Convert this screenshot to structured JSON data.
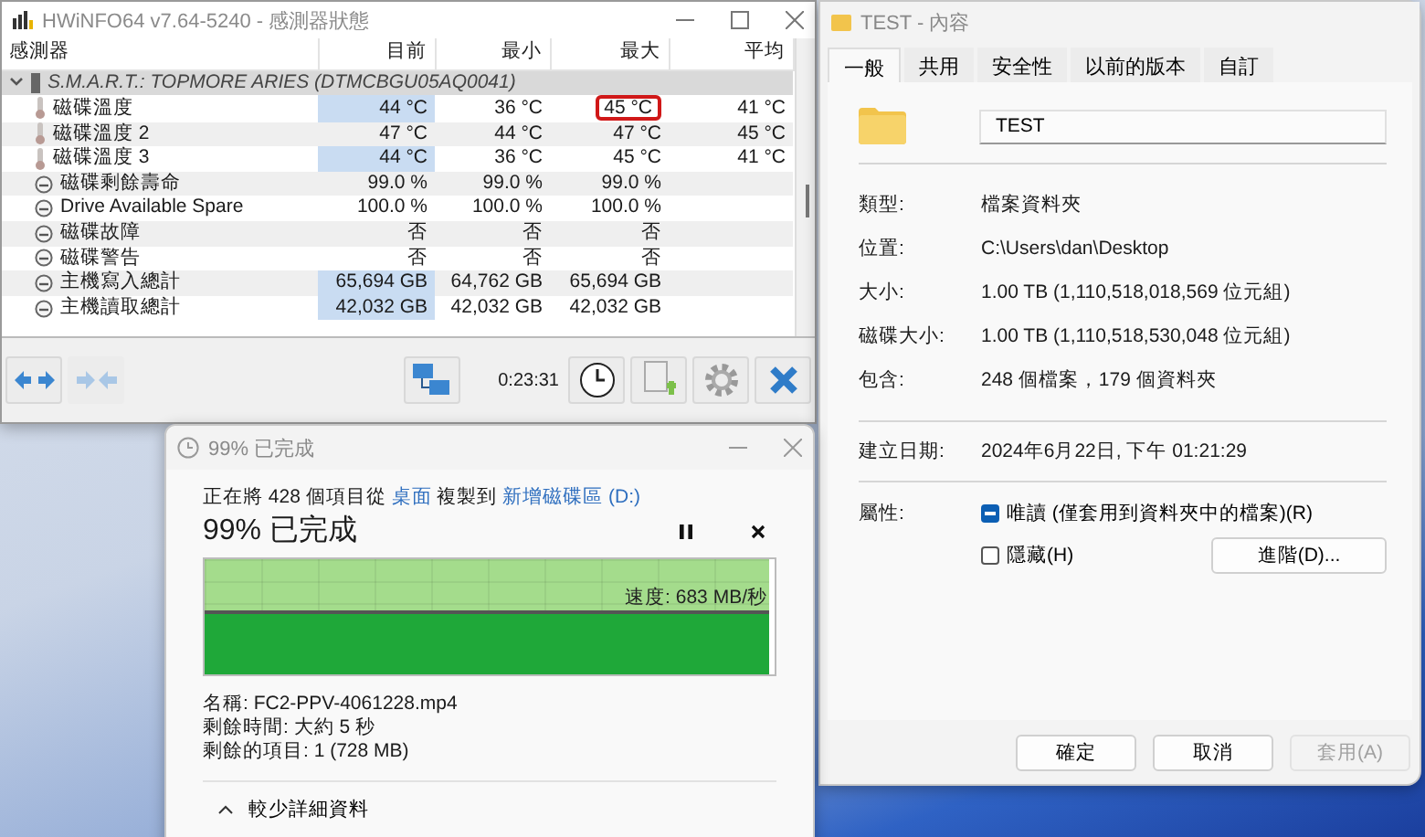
{
  "hwinfo": {
    "title": "HWiNFO64 v7.64-5240 - 感測器狀態",
    "columns": [
      "感測器",
      "目前",
      "最小",
      "最大",
      "平均"
    ],
    "group": {
      "label": "S.M.A.R.T.: TOPMORE ARIES (DTMCBGU05AQ0041)",
      "expanded": true
    },
    "rows": [
      {
        "kind": "temperature",
        "name": "磁碟溫度",
        "current": "44 °C",
        "min": "36 °C",
        "max": "45 °C",
        "avg": "41 °C",
        "highlighted": true,
        "max_marked": true
      },
      {
        "kind": "temperature",
        "name": "磁碟溫度 2",
        "current": "47 °C",
        "min": "44 °C",
        "max": "47 °C",
        "avg": "45 °C",
        "highlighted": false,
        "max_marked": false
      },
      {
        "kind": "temperature",
        "name": "磁碟溫度 3",
        "current": "44 °C",
        "min": "36 °C",
        "max": "45 °C",
        "avg": "41 °C",
        "highlighted": true,
        "max_marked": false
      },
      {
        "kind": "gauge",
        "name": "磁碟剩餘壽命",
        "current": "99.0 %",
        "min": "99.0 %",
        "max": "99.0 %",
        "highlighted": false,
        "max_marked": false
      },
      {
        "kind": "gauge",
        "name": "Drive Available Spare",
        "current": "100.0 %",
        "min": "100.0 %",
        "max": "100.0 %",
        "highlighted": false,
        "max_marked": false
      },
      {
        "kind": "gauge",
        "name": "磁碟故障",
        "current": "否",
        "min": "否",
        "max": "否",
        "highlighted": false,
        "max_marked": false
      },
      {
        "kind": "gauge",
        "name": "磁碟警告",
        "current": "否",
        "min": "否",
        "max": "否",
        "highlighted": false,
        "max_marked": false
      },
      {
        "kind": "gauge",
        "name": "主機寫入總計",
        "current": "65,694 GB",
        "min": "64,762 GB",
        "max": "65,694 GB",
        "highlighted": true,
        "max_marked": false
      },
      {
        "kind": "gauge",
        "name": "主機讀取總計",
        "current": "42,032 GB",
        "min": "42,032 GB",
        "max": "42,032 GB",
        "highlighted": true,
        "max_marked": false
      }
    ],
    "elapsed": "0:23:31"
  },
  "copy": {
    "title": "99% 已完成",
    "summary": [
      {
        "kind": "text",
        "text": "正在將 428 個項目從 "
      },
      {
        "kind": "link",
        "text": "桌面"
      },
      {
        "kind": "text",
        "text": " 複製到 "
      },
      {
        "kind": "link",
        "text": "新增磁碟區 (D:)"
      }
    ],
    "heading": "99% 已完成",
    "level": 0.99,
    "speed": "速度: 683 MB/秒",
    "details": [
      "名稱: FC2-PPV-4061228.mp4",
      "剩餘時間: 大約 5 秒",
      "剩餘的項目: 1 (728 MB)"
    ],
    "toggle": "較少詳細資料"
  },
  "properties": {
    "title": "TEST - 內容",
    "tabs": [
      {
        "label": "一般",
        "selected": true
      },
      {
        "label": "共用",
        "selected": false
      },
      {
        "label": "安全性",
        "selected": false
      },
      {
        "label": "以前的版本",
        "selected": false
      },
      {
        "label": "自訂",
        "selected": false
      }
    ],
    "name": "TEST",
    "info": [
      {
        "label": "類型:",
        "value": "檔案資料夾"
      },
      {
        "label": "位置:",
        "value": "C:\\Users\\dan\\Desktop"
      },
      {
        "label": "大小:",
        "value": "1.00 TB (1,110,518,018,569 位元組)"
      },
      {
        "label": "磁碟大小:",
        "value": "1.00 TB (1,110,518,530,048 位元組)"
      },
      {
        "label": "包含:",
        "value": "248 個檔案，179 個資料夾"
      }
    ],
    "created": {
      "label": "建立日期:",
      "value": "2024年6月22日, 下午 01:21:29"
    },
    "attributes_label": "屬性:",
    "attributes": [
      {
        "label": "唯讀 (僅套用到資料夾中的檔案)(R)",
        "checked": true,
        "indeterminate": true
      },
      {
        "label": "隱藏(H)",
        "checked": false,
        "indeterminate": false
      }
    ],
    "advanced": "進階(D)...",
    "buttons": [
      {
        "label": "確定",
        "disabled": false
      },
      {
        "label": "取消",
        "disabled": false
      },
      {
        "label": "套用(A)",
        "disabled": true
      }
    ]
  }
}
